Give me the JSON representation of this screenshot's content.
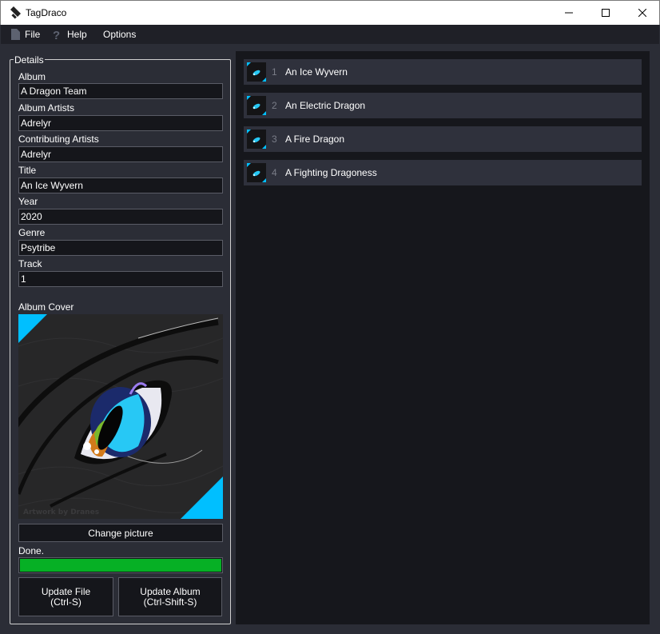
{
  "window": {
    "title": "TagDraco"
  },
  "menu": {
    "file": "File",
    "help": "Help",
    "options": "Options"
  },
  "details": {
    "legend": "Details",
    "fields": {
      "album": {
        "label": "Album",
        "value": "A Dragon Team"
      },
      "album_artists": {
        "label": "Album Artists",
        "value": "Adrelyr"
      },
      "contributing_artists": {
        "label": "Contributing Artists",
        "value": "Adrelyr"
      },
      "title": {
        "label": "Title",
        "value": "An Ice Wyvern"
      },
      "year": {
        "label": "Year",
        "value": "2020"
      },
      "genre": {
        "label": "Genre",
        "value": "Psytribe"
      },
      "track": {
        "label": "Track",
        "value": "1"
      }
    },
    "album_cover_label": "Album Cover",
    "cover_watermark": "Artwork by Dranes",
    "change_picture": "Change picture",
    "status": "Done.",
    "progress": 1.0,
    "update_file": {
      "line1": "Update File",
      "line2": "(Ctrl-S)"
    },
    "update_album": {
      "line1": "Update Album",
      "line2": "(Ctrl-Shift-S)"
    }
  },
  "tracks": [
    {
      "number": "1",
      "title": "An Ice Wyvern"
    },
    {
      "number": "2",
      "title": "An Electric Dragon"
    },
    {
      "number": "3",
      "title": "A Fire Dragon"
    },
    {
      "number": "4",
      "title": "A Fighting Dragoness"
    }
  ],
  "colors": {
    "accent": "#00bfff",
    "progress": "#06b025",
    "background": "#2b2d36",
    "list_background": "#16171c",
    "track_row": "#2f313c"
  }
}
